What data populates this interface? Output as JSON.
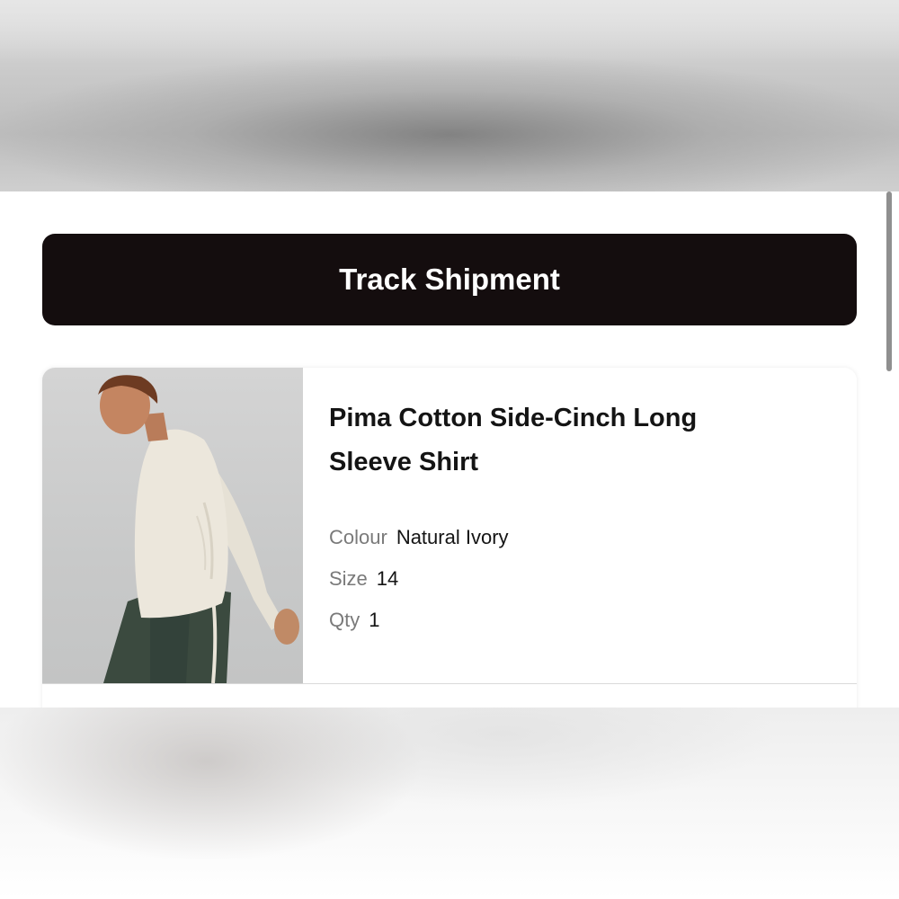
{
  "actions": {
    "track_shipment_label": "Track Shipment"
  },
  "product": {
    "title_line1": "Pima Cotton Side-Cinch Long",
    "title_line2": "Sleeve Shirt",
    "colour_label": "Colour",
    "colour_value": "Natural Ivory",
    "size_label": "Size",
    "size_value": "14",
    "qty_label": "Qty",
    "qty_value": "1",
    "image_icon": "product-photo-model-icon"
  },
  "colors": {
    "button_bg": "#140d0e",
    "button_text": "#ffffff",
    "label_text": "#7a7a7a",
    "value_text": "#141414"
  }
}
